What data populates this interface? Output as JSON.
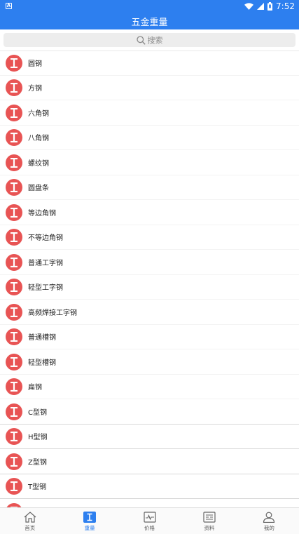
{
  "status_bar": {
    "time": "7:52",
    "app_indicator": "A"
  },
  "app_bar": {
    "title": "五金重量"
  },
  "search": {
    "placeholder": "搜索"
  },
  "list": {
    "items": [
      {
        "label": "圆钢"
      },
      {
        "label": "方钢"
      },
      {
        "label": "六角钢"
      },
      {
        "label": "八角钢"
      },
      {
        "label": "螺纹钢"
      },
      {
        "label": "圆盘条"
      },
      {
        "label": "等边角钢"
      },
      {
        "label": "不等边角钢"
      },
      {
        "label": "普通工字钢"
      },
      {
        "label": "轻型工字钢"
      },
      {
        "label": "高频焊接工字钢"
      },
      {
        "label": "普通槽钢"
      },
      {
        "label": "轻型槽钢"
      },
      {
        "label": "扁钢"
      },
      {
        "label": "C型钢"
      },
      {
        "label": "H型钢"
      },
      {
        "label": "Z型钢"
      },
      {
        "label": "T型钢"
      },
      {
        "label": ""
      }
    ]
  },
  "tab_bar": {
    "tabs": [
      {
        "label": "首页",
        "icon": "home-icon",
        "active": false
      },
      {
        "label": "重量",
        "icon": "weight-icon",
        "active": true
      },
      {
        "label": "价格",
        "icon": "price-chart-icon",
        "active": false
      },
      {
        "label": "资料",
        "icon": "document-icon",
        "active": false
      },
      {
        "label": "我的",
        "icon": "user-icon",
        "active": false
      }
    ]
  },
  "colors": {
    "primary": "#2d7fef",
    "badge": "#e85454"
  }
}
